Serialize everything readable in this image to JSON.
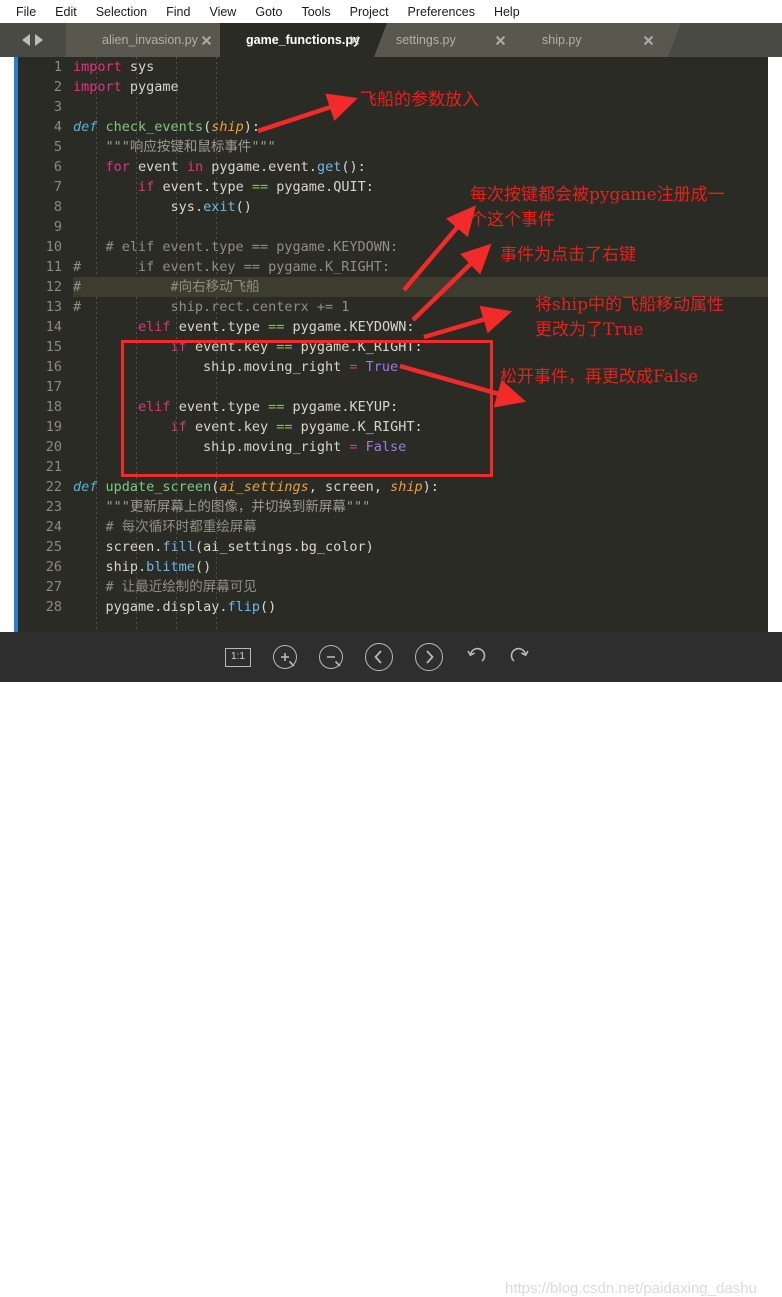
{
  "menu": {
    "items": [
      {
        "label": "File"
      },
      {
        "label": "Edit"
      },
      {
        "label": "Selection"
      },
      {
        "label": "Find"
      },
      {
        "label": "View"
      },
      {
        "label": "Goto"
      },
      {
        "label": "Tools"
      },
      {
        "label": "Project"
      },
      {
        "label": "Preferences"
      },
      {
        "label": "Help"
      }
    ]
  },
  "tabs": [
    {
      "label": "alien_invasion.py",
      "active": false
    },
    {
      "label": "game_functions.py",
      "active": true
    },
    {
      "label": "settings.py",
      "active": false
    },
    {
      "label": "ship.py",
      "active": false
    }
  ],
  "editor": {
    "active_line": 12,
    "lines": [
      {
        "n": 1,
        "text": "import sys"
      },
      {
        "n": 2,
        "text": "import pygame"
      },
      {
        "n": 3,
        "text": ""
      },
      {
        "n": 4,
        "text": "def check_events(ship):"
      },
      {
        "n": 5,
        "text": "    \"\"\"响应按键和鼠标事件\"\"\""
      },
      {
        "n": 6,
        "text": "    for event in pygame.event.get():"
      },
      {
        "n": 7,
        "text": "        if event.type == pygame.QUIT:"
      },
      {
        "n": 8,
        "text": "            sys.exit()"
      },
      {
        "n": 9,
        "text": ""
      },
      {
        "n": 10,
        "text": "    # elif event.type == pygame.KEYDOWN:"
      },
      {
        "n": 11,
        "text": "#       if event.key == pygame.K_RIGHT:"
      },
      {
        "n": 12,
        "text": "#           #向右移动飞船"
      },
      {
        "n": 13,
        "text": "#           ship.rect.centerx += 1"
      },
      {
        "n": 14,
        "text": "        elif event.type == pygame.KEYDOWN:"
      },
      {
        "n": 15,
        "text": "            if event.key == pygame.K_RIGHT:"
      },
      {
        "n": 16,
        "text": "                ship.moving_right = True"
      },
      {
        "n": 17,
        "text": ""
      },
      {
        "n": 18,
        "text": "        elif event.type == pygame.KEYUP:"
      },
      {
        "n": 19,
        "text": "            if event.key == pygame.K_RIGHT:"
      },
      {
        "n": 20,
        "text": "                ship.moving_right = False"
      },
      {
        "n": 21,
        "text": ""
      },
      {
        "n": 22,
        "text": "def update_screen(ai_settings, screen, ship):"
      },
      {
        "n": 23,
        "text": "    \"\"\"更新屏幕上的图像，并切换到新屏幕\"\"\""
      },
      {
        "n": 24,
        "text": "    # 每次循环时都重绘屏幕"
      },
      {
        "n": 25,
        "text": "    screen.fill(ai_settings.bg_color)"
      },
      {
        "n": 26,
        "text": "    ship.blitme()"
      },
      {
        "n": 27,
        "text": "    # 让最近绘制的屏幕可见"
      },
      {
        "n": 28,
        "text": "    pygame.display.flip()"
      }
    ]
  },
  "annotations": [
    {
      "id": "a1",
      "text": "飞船的参数放入"
    },
    {
      "id": "a2",
      "text": "每次按键都会被pygame注册成一\n个这个事件"
    },
    {
      "id": "a3",
      "text": "事件为点击了右键"
    },
    {
      "id": "a4",
      "text": "将ship中的飞船移动属性\n更改为了True"
    },
    {
      "id": "a5",
      "text": "松开事件，再更改成False"
    }
  ],
  "bottombar": {
    "tools": [
      {
        "name": "zoom-reset",
        "label": "1:1"
      },
      {
        "name": "zoom-in",
        "label": "+"
      },
      {
        "name": "zoom-out",
        "label": "−"
      },
      {
        "name": "prev",
        "label": "‹"
      },
      {
        "name": "next",
        "label": "›"
      },
      {
        "name": "rotate-left",
        "label": "↺"
      },
      {
        "name": "rotate-right",
        "label": "↻"
      }
    ],
    "watermark": "https://blog.csdn.net/paidaxing_dashu"
  },
  "colors": {
    "accent_blue": "#2a7fc9",
    "annotation_red": "#e8201c",
    "box_red": "#f22a2a",
    "editor_bg": "#2b2b26",
    "tab_bg": "#58584f",
    "active_tab_bg": "#2b2b26",
    "bottombar_bg": "#2e2e2e"
  }
}
